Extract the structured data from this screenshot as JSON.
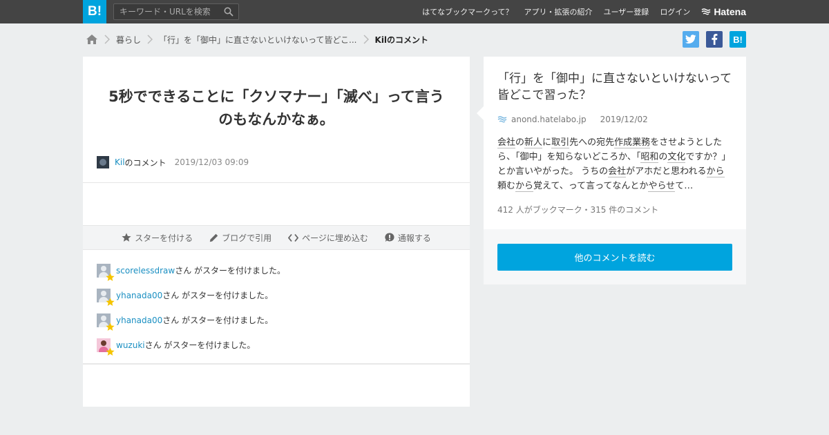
{
  "header": {
    "logo": "B!",
    "search": {
      "placeholder": "キーワード・URLを検索"
    },
    "nav": [
      {
        "label": "はてなブックマークって？"
      },
      {
        "label": "アプリ・拡張の紹介"
      },
      {
        "label": "ユーザー登録"
      },
      {
        "label": "ログイン"
      }
    ],
    "brand": "Hatena"
  },
  "breadcrumb": {
    "items": [
      {
        "label": "暮らし"
      },
      {
        "label": "「行」を「御中」に直さないといけないって皆どこ..."
      }
    ],
    "current": "Kilのコメント"
  },
  "share": {
    "bookmark_label": "B!"
  },
  "comment": {
    "title": "5秒でできることに「クソマナー」「滅べ」って言うのもなんかなぁ。",
    "author": "Kil",
    "author_suffix": "のコメント",
    "date": "2019/12/03 09:09"
  },
  "actions": [
    {
      "label": "スターを付ける"
    },
    {
      "label": "ブログで引用"
    },
    {
      "label": "ページに埋め込む"
    },
    {
      "label": "通報する"
    }
  ],
  "stars": {
    "suffix": "さん がスターを付けました。",
    "items": [
      {
        "user": "scorelessdraw"
      },
      {
        "user": "yhanada00"
      },
      {
        "user": "yhanada00"
      },
      {
        "user": "wuzuki"
      }
    ]
  },
  "entry": {
    "title": "「行」を「御中」に直さないといけないって皆どこで習った？",
    "domain": "anond.hatelabo.jp",
    "date": "2019/12/02",
    "snippet": [
      {
        "text": "会社",
        "kw": true
      },
      {
        "text": "の",
        "kw": false
      },
      {
        "text": "新人",
        "kw": true
      },
      {
        "text": "に",
        "kw": false
      },
      {
        "text": "取引",
        "kw": true
      },
      {
        "text": "先への宛先",
        "kw": false
      },
      {
        "text": "作成",
        "kw": true
      },
      {
        "text": "業務",
        "kw": true
      },
      {
        "text": "をさせようとしたら、「御中」を知らないどころか、「",
        "kw": false
      },
      {
        "text": "昭和",
        "kw": true
      },
      {
        "text": "の",
        "kw": false
      },
      {
        "text": "文化",
        "kw": true
      },
      {
        "text": "ですか？」とか言いやがった。 うちの",
        "kw": false
      },
      {
        "text": "会社",
        "kw": true
      },
      {
        "text": "がアホだと思われる",
        "kw": false
      },
      {
        "text": "から",
        "kw": true
      },
      {
        "text": "頼む",
        "kw": false
      },
      {
        "text": "から",
        "kw": true
      },
      {
        "text": "覚えて、って言ってなんとか",
        "kw": false
      },
      {
        "text": "やらせ",
        "kw": true
      },
      {
        "text": "て…",
        "kw": false
      }
    ],
    "stats": "412 人がブックマーク・315 件のコメント"
  },
  "read_more_label": "他のコメントを読む",
  "colors": {
    "brand": "#00a4de",
    "twitter": "#55acee",
    "facebook": "#3b5998",
    "hatena": "#00a4de",
    "star": "#f5c400"
  }
}
